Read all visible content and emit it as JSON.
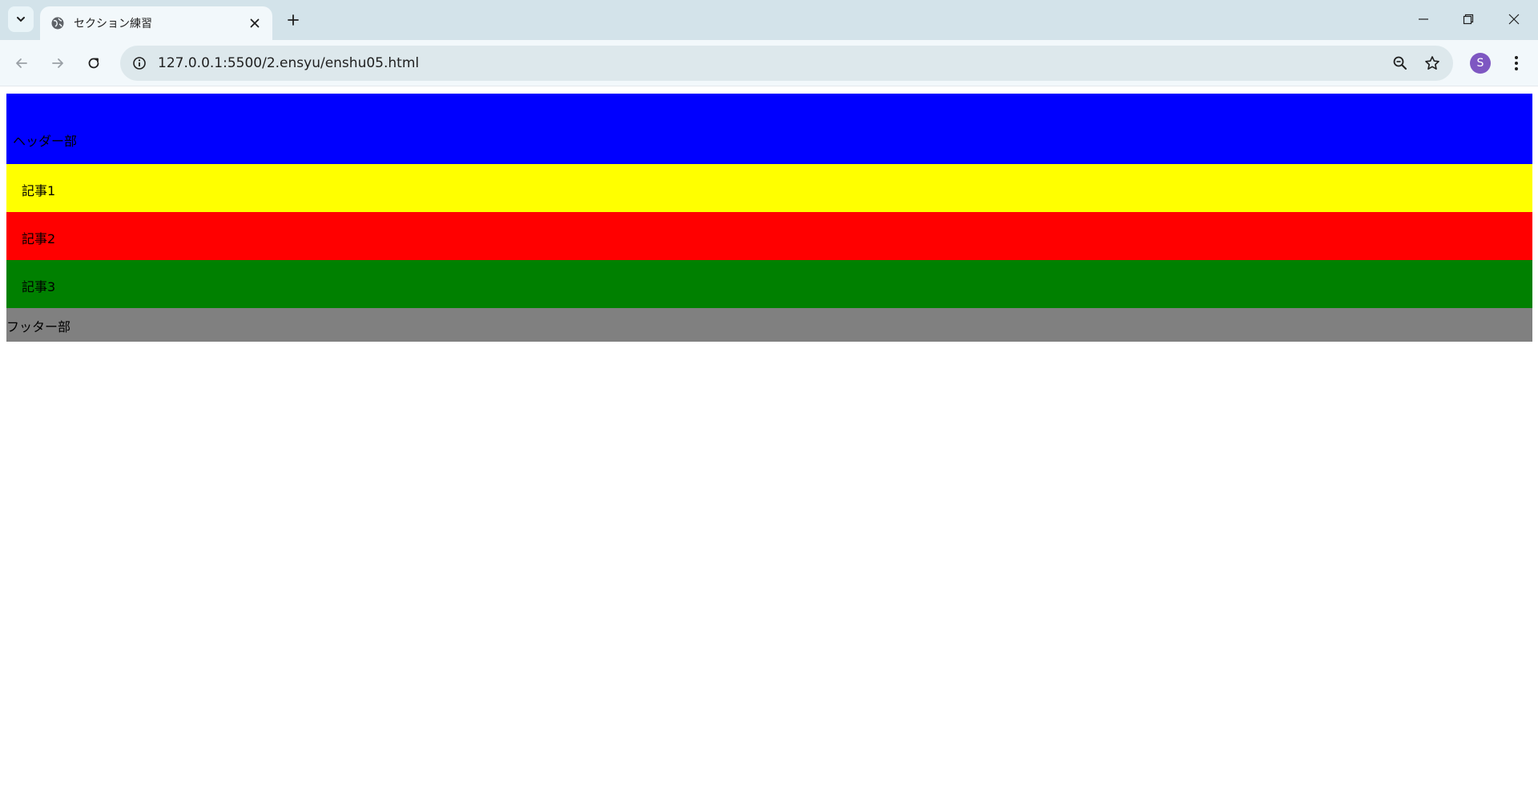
{
  "browser": {
    "tab_title": "セクション練習",
    "url": "127.0.0.1:5500/2.ensyu/enshu05.html",
    "profile_initial": "S",
    "icons": {
      "tab_search": "chevron-down-icon",
      "favicon": "globe-icon",
      "tab_close": "close-icon",
      "new_tab": "plus-icon",
      "minimize": "minimize-icon",
      "restore": "restore-icon",
      "close_window": "close-icon",
      "back": "arrow-left-icon",
      "forward": "arrow-right-icon",
      "reload": "reload-icon",
      "site_info": "info-icon",
      "zoom": "zoom-out-icon",
      "bookmark": "star-icon",
      "menu": "kebab-menu-icon"
    },
    "colors": {
      "tabstrip": "#d3e3ea",
      "toolbar": "#f2f8fb",
      "omnibox": "#dde8ec",
      "avatar": "#7e57c2"
    }
  },
  "page": {
    "header": {
      "text": "ヘッダー部",
      "color": "#0000ff"
    },
    "articles": [
      {
        "text": "記事1",
        "color": "#ffff00"
      },
      {
        "text": "記事2",
        "color": "#ff0000"
      },
      {
        "text": "記事3",
        "color": "#008000"
      }
    ],
    "footer": {
      "text": "フッター部",
      "color": "#808080"
    }
  }
}
